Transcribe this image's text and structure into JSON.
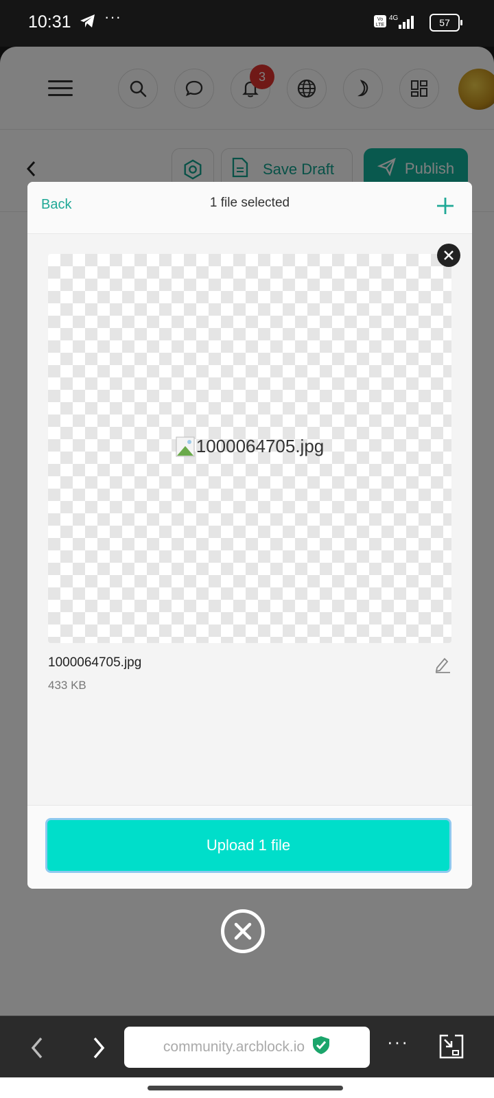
{
  "status_bar": {
    "time": "10:31",
    "more": "···",
    "network": "4G",
    "volte": "Vo LTE",
    "battery": "57"
  },
  "nav": {
    "notifications_count": "3"
  },
  "editor_toolbar": {
    "save_draft": "Save Draft",
    "publish": "Publish"
  },
  "modal": {
    "back": "Back",
    "title": "1 file selected",
    "file_name": "1000064705.jpg",
    "file_size": "433 KB",
    "preview_alt": "1000064705.jpg",
    "upload_label": "Upload 1 file"
  },
  "browser": {
    "url": "community.arcblock.io",
    "more": "···"
  },
  "colors": {
    "accent": "#1fa896",
    "upload_button": "#00deca",
    "badge": "#e0322f",
    "publish": "#12b39c"
  },
  "icons": [
    "telegram-icon",
    "signal-icon",
    "battery-icon",
    "menu-icon",
    "search-icon",
    "chat-icon",
    "bell-icon",
    "globe-icon",
    "moon-icon",
    "apps-icon",
    "avatar",
    "chevron-left-icon",
    "settings-icon",
    "document-icon",
    "send-icon",
    "plus-icon",
    "close-icon",
    "broken-image-icon",
    "edit-icon",
    "shield-check-icon",
    "tabs-icon"
  ]
}
